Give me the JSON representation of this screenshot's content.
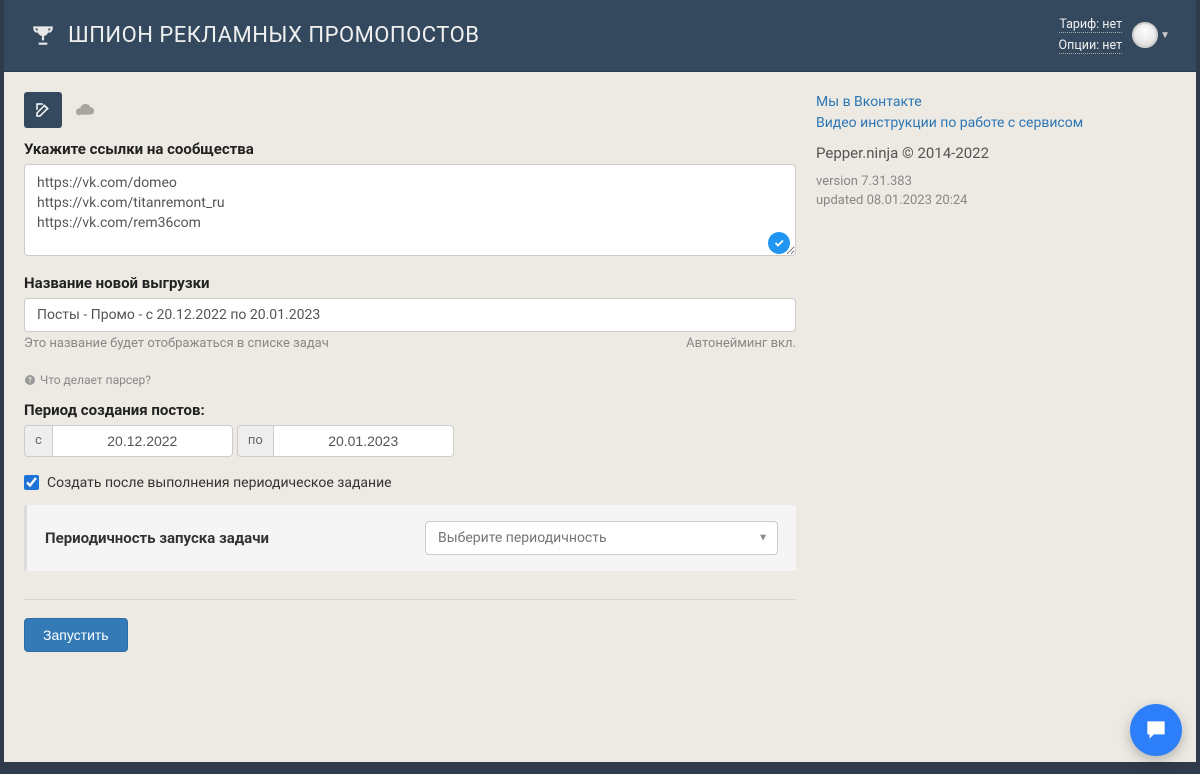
{
  "header": {
    "title": "ШПИОН РЕКЛАМНЫХ ПРОМОПОСТОВ",
    "tariff": "Тариф: нет",
    "options": "Опции: нет"
  },
  "sidebar": {
    "link_vk": "Мы в Вконтакте",
    "link_video": "Видео инструкции по работе с сервисом",
    "brand": "Pepper.ninja © 2014-2022",
    "version": "version 7.31.383",
    "updated": "updated 08.01.2023 20:24"
  },
  "form": {
    "links_label": "Укажите ссылки на сообщества",
    "links_value": "https://vk.com/domeo\nhttps://vk.com/titanremont_ru\nhttps://vk.com/rem36com",
    "name_label": "Название новой выгрузки",
    "name_value": "Посты - Промо - с 20.12.2022 по 20.01.2023",
    "name_hint_left": "Это название будет отображаться в списке задач",
    "name_hint_right": "Автонейминг вкл.",
    "help_label": "Что делает парсер?",
    "period_label": "Период создания постов:",
    "from_prefix": "с",
    "from_value": "20.12.2022",
    "to_prefix": "по",
    "to_value": "20.01.2023",
    "periodic_checkbox": "Создать после выполнения периодическое задание",
    "periodic_checked": true,
    "frequency_label": "Периодичность запуска задачи",
    "frequency_placeholder": "Выберите периодичность",
    "run_button": "Запустить"
  }
}
